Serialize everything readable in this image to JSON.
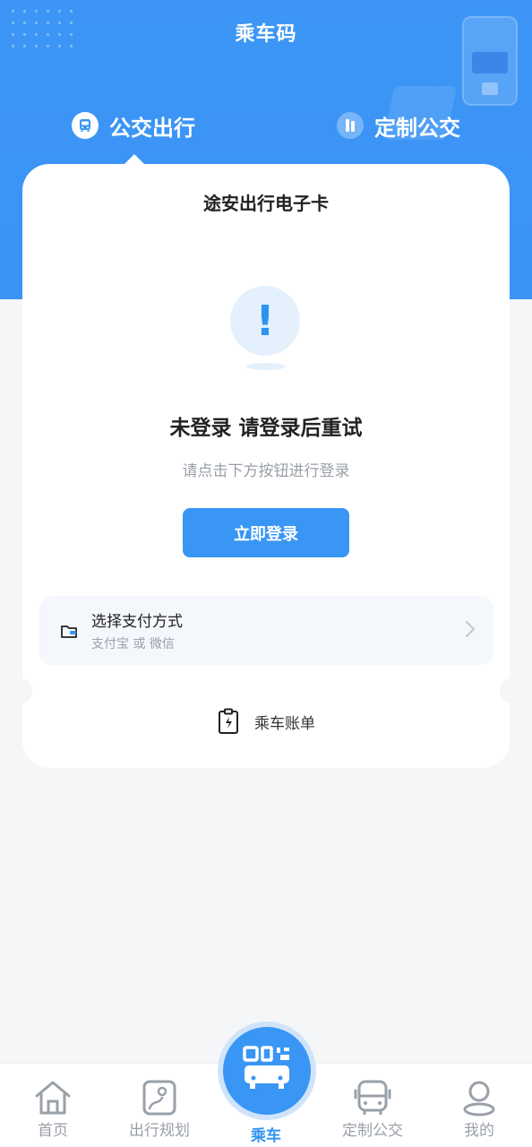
{
  "header": {
    "title": "乘车码",
    "tabs": [
      {
        "label": "公交出行",
        "icon": "bus-icon",
        "active": true
      },
      {
        "label": "定制公交",
        "icon": "custom-bus-icon",
        "active": false
      }
    ]
  },
  "card": {
    "title": "途安出行电子卡",
    "status_icon": "exclamation-icon",
    "message": "未登录 请登录后重试",
    "hint": "请点击下方按钮进行登录",
    "login_label": "立即登录",
    "payment": {
      "title": "选择支付方式",
      "subtitle": "支付宝 或 微信",
      "icon": "wallet-icon"
    },
    "bill": {
      "label": "乘车账单",
      "icon": "bill-icon"
    }
  },
  "tabbar": {
    "items": [
      {
        "label": "首页",
        "icon": "home-icon"
      },
      {
        "label": "出行规划",
        "icon": "map-icon"
      },
      {
        "label": "乘车",
        "icon": "qr-bus-icon",
        "active": true
      },
      {
        "label": "定制公交",
        "icon": "bus-icon"
      },
      {
        "label": "我的",
        "icon": "user-icon"
      }
    ]
  },
  "colors": {
    "primary": "#3996f5",
    "background": "#f5f6f8",
    "muted": "#9aa0a8"
  }
}
